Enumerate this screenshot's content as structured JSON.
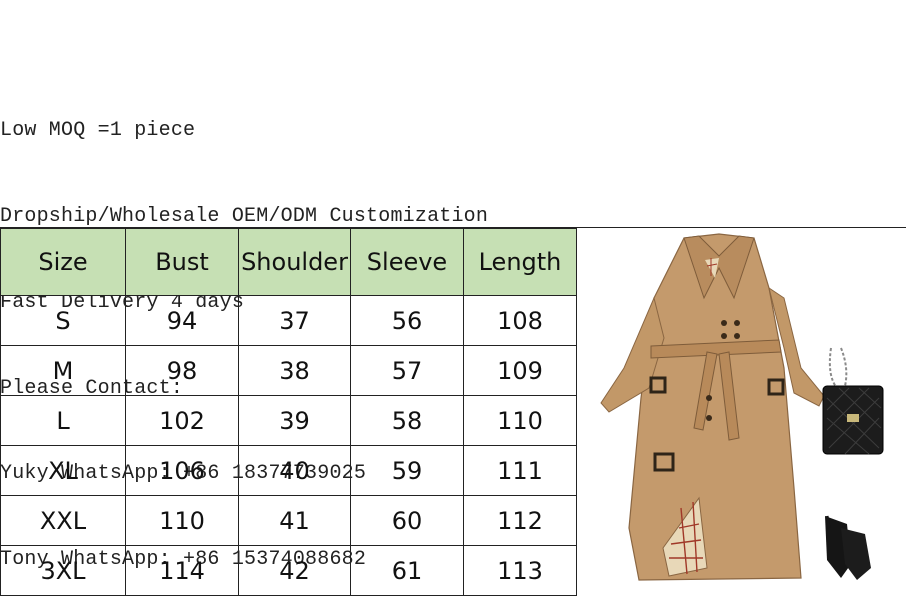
{
  "info_lines": [
    "Low MOQ =1 piece",
    "Dropship/Wholesale OEM/ODM Customization",
    "Fast Delivery 4 days",
    "Please Contact:",
    "Yuky WhatsApp: +86 18377739025",
    "Tony WhatsApp: +86 15374088682"
  ],
  "size_table": {
    "header_color": "#c6e0b4",
    "headers": [
      "Size",
      "Bust",
      "Shoulder",
      "Sleeve",
      "Length"
    ],
    "rows": [
      [
        "S",
        "94",
        "37",
        "56",
        "108"
      ],
      [
        "M",
        "98",
        "38",
        "57",
        "109"
      ],
      [
        "L",
        "102",
        "39",
        "58",
        "110"
      ],
      [
        "XL",
        "106",
        "40",
        "59",
        "111"
      ],
      [
        "XXL",
        "110",
        "41",
        "60",
        "112"
      ],
      [
        "3XL",
        "114",
        "42",
        "61",
        "113"
      ]
    ]
  },
  "product_image": {
    "coat_color": "#c49a6c",
    "items": [
      "trench-coat",
      "quilted-chain-bag",
      "black-heels"
    ]
  }
}
